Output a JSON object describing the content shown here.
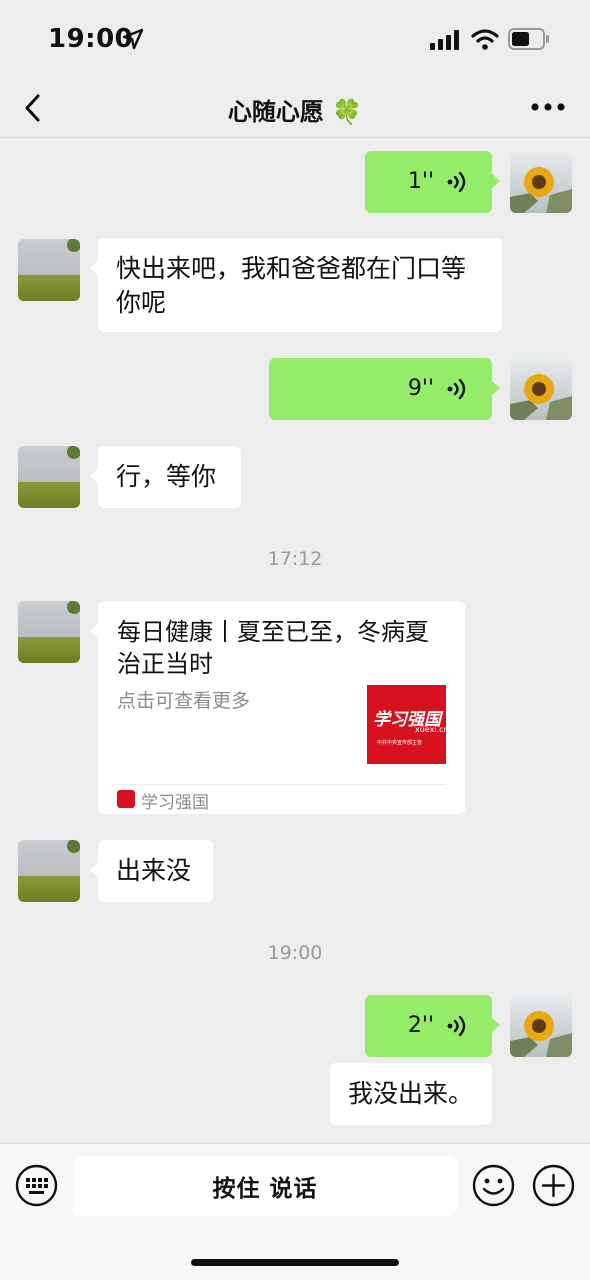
{
  "status_bar": {
    "time": "19:00"
  },
  "nav": {
    "title": "心随心愿",
    "title_emoji": "🍀"
  },
  "messages": [
    {
      "side": "out",
      "type": "voice",
      "duration": "1''"
    },
    {
      "side": "in",
      "type": "text",
      "text": "快出来吧，我和爸爸都在门口等你呢"
    },
    {
      "side": "out",
      "type": "voice",
      "duration": "9''"
    },
    {
      "side": "in",
      "type": "text",
      "text": "行，等你"
    },
    {
      "type": "timestamp",
      "text": "17:12"
    },
    {
      "side": "in",
      "type": "article",
      "title": "每日健康丨夏至已至，冬病夏治正当时",
      "desc": "点击可查看更多",
      "thumb_brand": "学习强国",
      "thumb_domain": "xuexi.cn",
      "thumb_slogan": "中共中央宣传部主管",
      "source": "学习强国"
    },
    {
      "side": "in",
      "type": "text",
      "text": "出来没"
    },
    {
      "type": "timestamp",
      "text": "19:00"
    },
    {
      "side": "out",
      "type": "voice",
      "duration": "2''"
    },
    {
      "side": "out",
      "type": "text",
      "text": "我没出来。"
    }
  ],
  "input_bar": {
    "talk_label": "按住 说话"
  },
  "icons": {
    "back": "chevron-left-icon",
    "more": "ellipsis-icon",
    "keyboard": "keyboard-icon",
    "emoji": "emoji-icon",
    "plus": "plus-icon",
    "voice": "voice-wave-icon"
  },
  "colors": {
    "out_bubble": "#95ec69",
    "in_bubble": "#ffffff",
    "background": "#ededed",
    "brand_red": "#d7111d"
  }
}
